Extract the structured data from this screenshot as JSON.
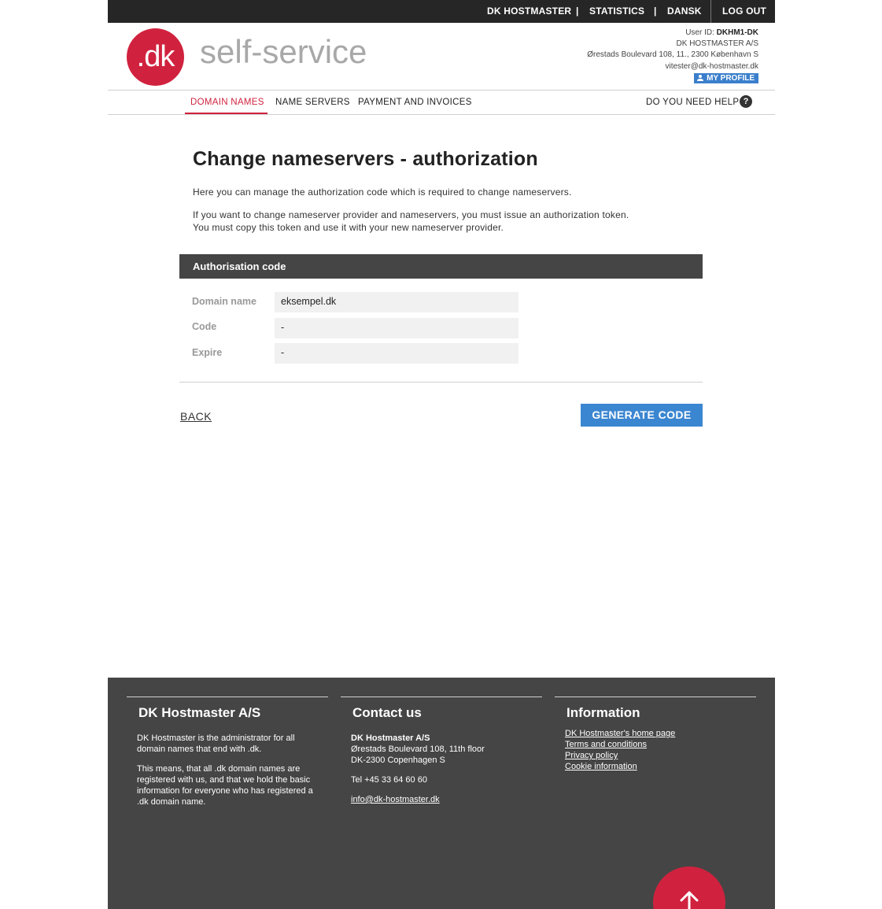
{
  "topbar": {
    "hostmaster": "DK HOSTMASTER",
    "statistics": "STATISTICS",
    "dansk": "DANSK",
    "logout": "LOG OUT",
    "separator": "|"
  },
  "header": {
    "logo_mark": ".dk",
    "logo_text": "self-service",
    "user_id_label": "User ID:",
    "user_id": "DKHM1-DK",
    "company": "DK HOSTMASTER A/S",
    "address": "Ørestads Boulevard 108, 11., 2300 København S",
    "email": "vitester@dk-hostmaster.dk",
    "profile_button": "MY PROFILE"
  },
  "nav": {
    "items": [
      "DOMAIN NAMES",
      "NAME SERVERS",
      "PAYMENT AND INVOICES"
    ],
    "help": "DO YOU NEED HELP",
    "help_icon": "?"
  },
  "main": {
    "title": "Change nameservers - authorization",
    "intro1": "Here you can manage the authorization code which is required to change nameservers.",
    "intro2_line1": "If you want to change nameserver provider and nameservers, you must issue an authorization token.",
    "intro2_line2": "You must copy this token and use it with your new nameserver provider.",
    "panel_title": "Authorisation code",
    "rows": [
      {
        "label": "Domain name",
        "value": "eksempel.dk"
      },
      {
        "label": "Code",
        "value": "-"
      },
      {
        "label": "Expire",
        "value": "-"
      }
    ],
    "back": "BACK",
    "generate": "GENERATE CODE"
  },
  "footer": {
    "col1": {
      "title": "DK Hostmaster A/S",
      "p1": "DK Hostmaster is the administrator for all domain names that end with .dk.",
      "p2": "This means, that all .dk domain names are registered with us, and that we hold the basic information for everyone who has registered a .dk domain name."
    },
    "col2": {
      "title": "Contact us",
      "company": "DK Hostmaster A/S",
      "street": "Ørestads Boulevard 108, 11th floor",
      "city": "DK-2300 Copenhagen S",
      "phone": "Tel +45 33 64 60 60",
      "email": "info@dk-hostmaster.dk"
    },
    "col3": {
      "title": "Information",
      "links": [
        "DK Hostmaster's home page",
        "Terms and conditions",
        "Privacy policy",
        "Cookie information"
      ]
    }
  },
  "colors": {
    "brand_red": "#d0223e",
    "button_blue": "#3b86d1",
    "dark": "#262626",
    "footer_bg": "#454545"
  }
}
